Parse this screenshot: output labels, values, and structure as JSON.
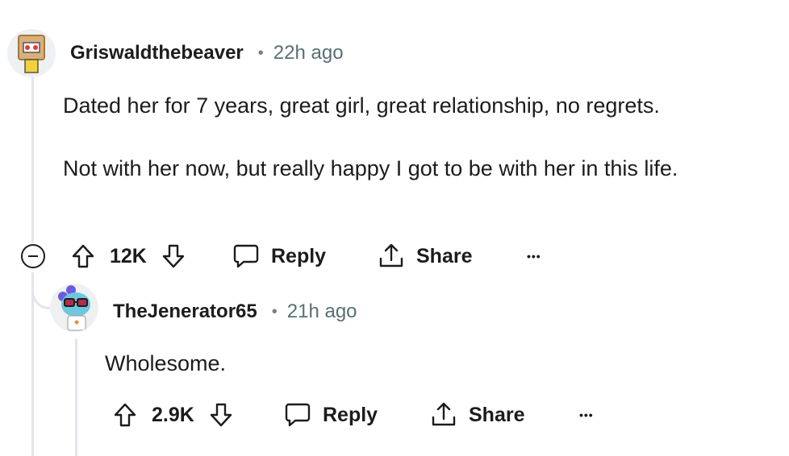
{
  "comments": [
    {
      "username": "Griswaldthebeaver",
      "separator": "•",
      "time": "22h ago",
      "paragraphs": [
        "Dated her for 7 years, great girl, great relationship, no regrets.",
        "Not with her now, but really happy I got to be with her in this life."
      ],
      "upvotes": "12K",
      "reply_label": "Reply",
      "share_label": "Share",
      "more_label": "•••"
    },
    {
      "username": "TheJenerator65",
      "separator": "•",
      "time": "21h ago",
      "paragraphs": [
        "Wholesome."
      ],
      "upvotes": "2.9K",
      "reply_label": "Reply",
      "share_label": "Share",
      "more_label": "•••"
    }
  ],
  "colors": {
    "thread_line": "#e3e6ea",
    "meta_text": "#576f76",
    "text": "#1c1c1c"
  }
}
